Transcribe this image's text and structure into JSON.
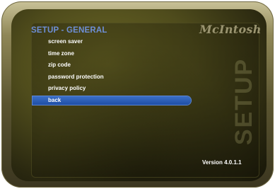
{
  "menu": {
    "title": "SETUP - GENERAL",
    "items": [
      {
        "label": "screen saver",
        "selected": false
      },
      {
        "label": "time zone",
        "selected": false
      },
      {
        "label": "zip code",
        "selected": false
      },
      {
        "label": "password protection",
        "selected": false
      },
      {
        "label": "privacy policy",
        "selected": false
      },
      {
        "label": "back",
        "selected": true
      }
    ]
  },
  "brand": {
    "logo_text": "McIntosh",
    "watermark": "SETUP"
  },
  "footer": {
    "version": "Version 4.0.1.1"
  },
  "colors": {
    "title_blue": "#6e8fd6",
    "highlight_blue": "#2a5bb3",
    "background_olive": "#4f4c1c",
    "text_white": "#ffffff"
  }
}
